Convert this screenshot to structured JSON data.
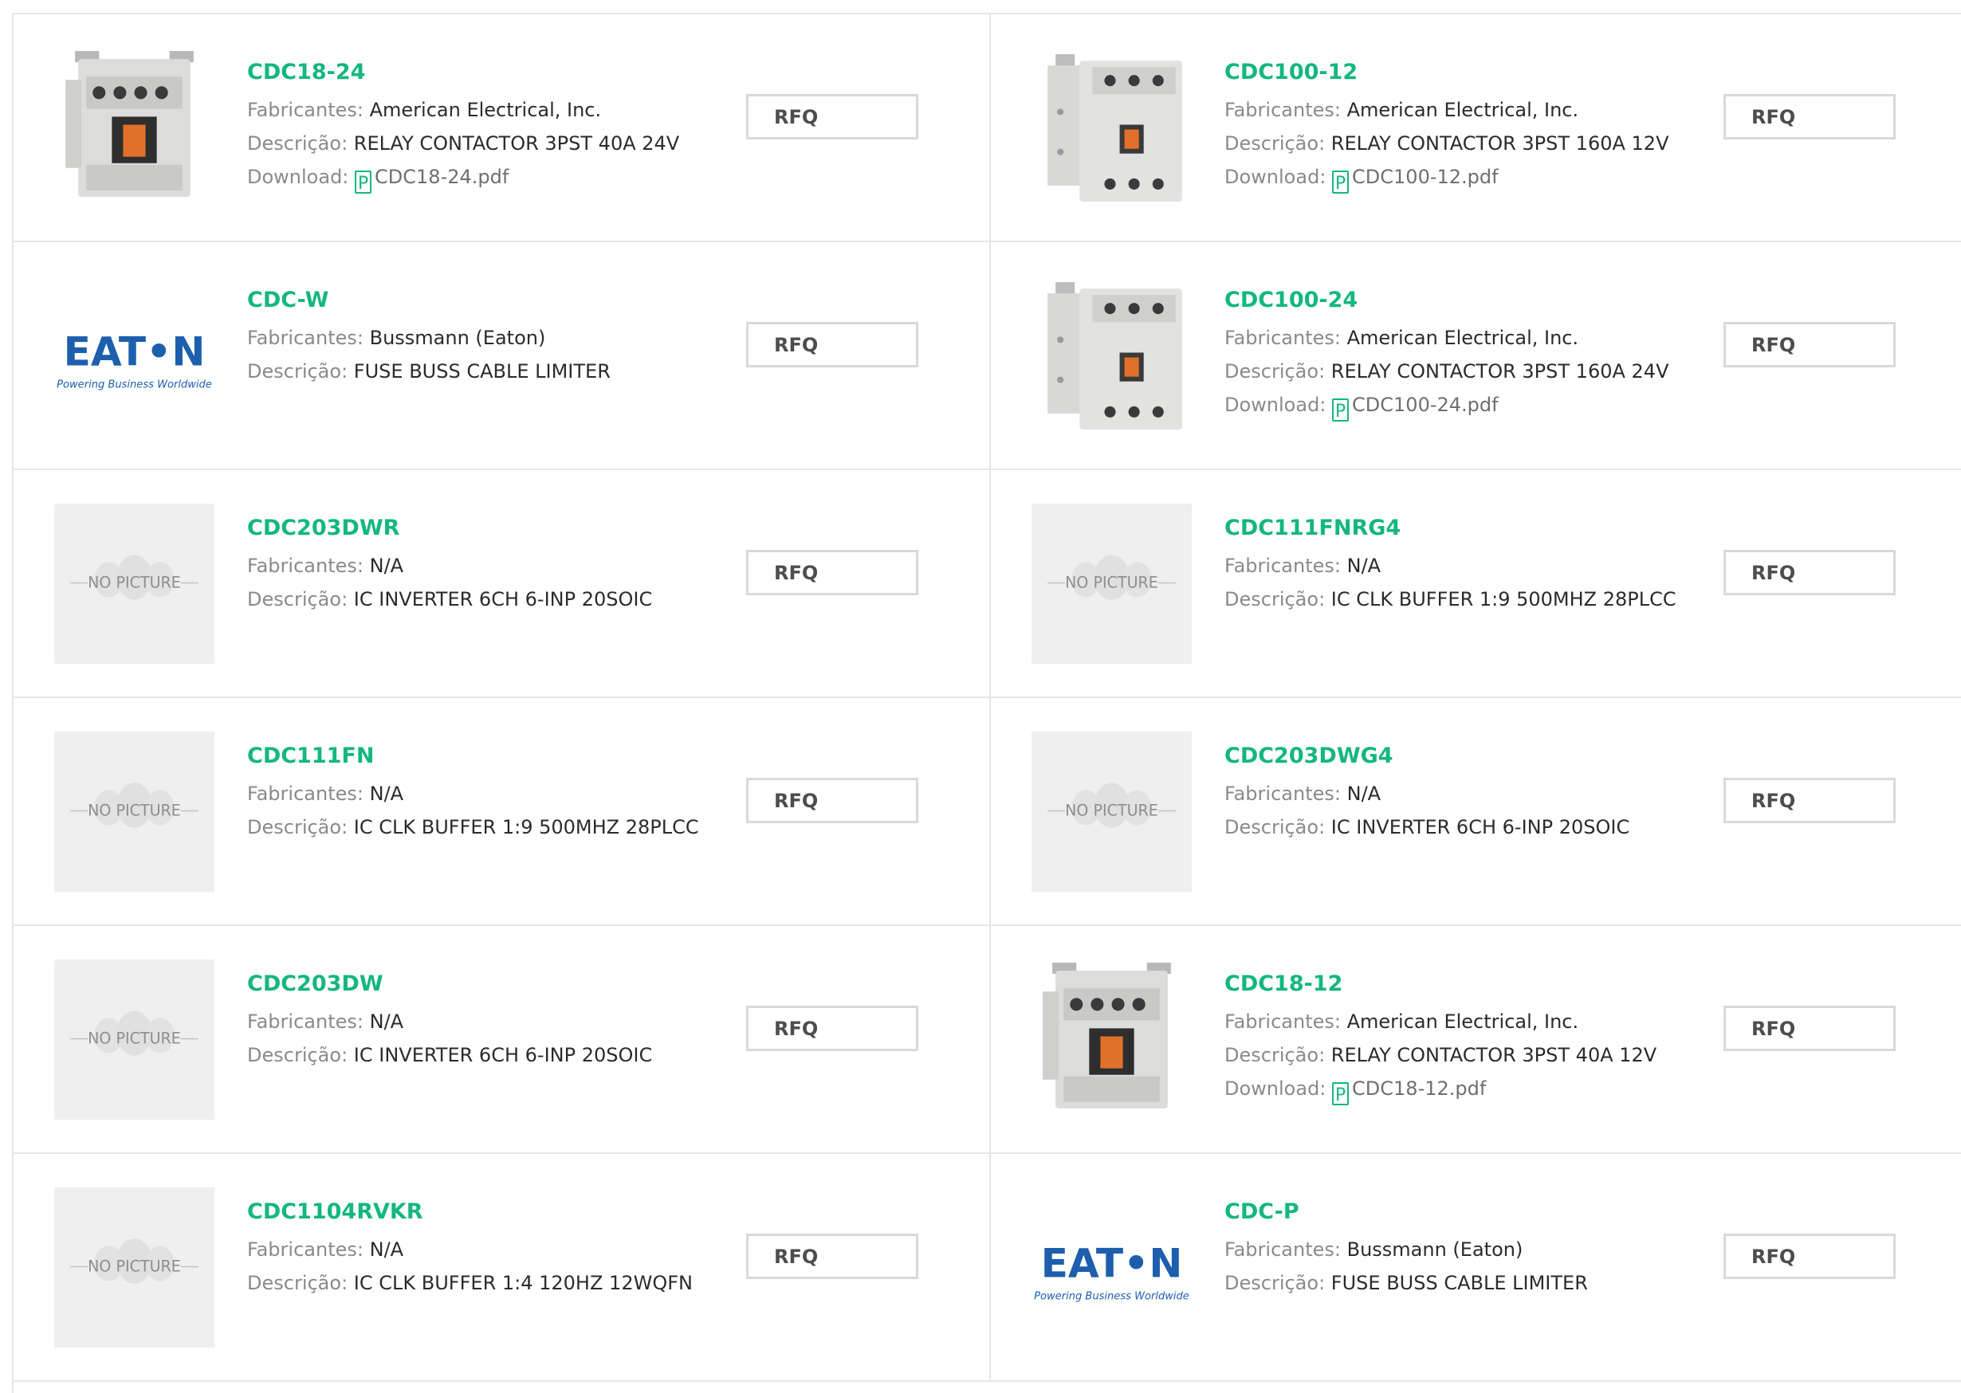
{
  "labels": {
    "manufacturer": "Fabricantes:",
    "description": "Descrição:",
    "download": "Download:",
    "rfq": "RFQ",
    "no_picture": "NO PICTURE",
    "pdf_icon_glyph": "P",
    "eaton_logo": "EAT•N",
    "eaton_tagline": "Powering Business Worldwide"
  },
  "colors": {
    "accent": "#14b681",
    "eaton_blue": "#1d5fad"
  },
  "products": [
    {
      "part": "CDC18-24",
      "manufacturer": "American Electrical, Inc.",
      "description": "RELAY CONTACTOR 3PST 40A 24V",
      "download": "CDC18-24.pdf",
      "image": "contactor-small"
    },
    {
      "part": "CDC100-12",
      "manufacturer": "American Electrical, Inc.",
      "description": "RELAY CONTACTOR 3PST 160A 12V",
      "download": "CDC100-12.pdf",
      "image": "contactor-large"
    },
    {
      "part": "CDC-W",
      "manufacturer": "Bussmann (Eaton)",
      "description": "FUSE BUSS CABLE LIMITER",
      "download": null,
      "image": "eaton-logo"
    },
    {
      "part": "CDC100-24",
      "manufacturer": "American Electrical, Inc.",
      "description": "RELAY CONTACTOR 3PST 160A 24V",
      "download": "CDC100-24.pdf",
      "image": "contactor-large"
    },
    {
      "part": "CDC203DWR",
      "manufacturer": "N/A",
      "description": "IC INVERTER 6CH 6-INP 20SOIC",
      "download": null,
      "image": "no-picture"
    },
    {
      "part": "CDC111FNRG4",
      "manufacturer": "N/A",
      "description": "IC CLK BUFFER 1:9 500MHZ 28PLCC",
      "download": null,
      "image": "no-picture"
    },
    {
      "part": "CDC111FN",
      "manufacturer": "N/A",
      "description": "IC CLK BUFFER 1:9 500MHZ 28PLCC",
      "download": null,
      "image": "no-picture"
    },
    {
      "part": "CDC203DWG4",
      "manufacturer": "N/A",
      "description": "IC INVERTER 6CH 6-INP 20SOIC",
      "download": null,
      "image": "no-picture"
    },
    {
      "part": "CDC203DW",
      "manufacturer": "N/A",
      "description": "IC INVERTER 6CH 6-INP 20SOIC",
      "download": null,
      "image": "no-picture"
    },
    {
      "part": "CDC18-12",
      "manufacturer": "American Electrical, Inc.",
      "description": "RELAY CONTACTOR 3PST 40A 12V",
      "download": "CDC18-12.pdf",
      "image": "contactor-small"
    },
    {
      "part": "CDC1104RVKR",
      "manufacturer": "N/A",
      "description": "IC CLK BUFFER 1:4 120HZ 12WQFN",
      "download": null,
      "image": "no-picture"
    },
    {
      "part": "CDC-P",
      "manufacturer": "Bussmann (Eaton)",
      "description": "FUSE BUSS CABLE LIMITER",
      "download": null,
      "image": "eaton-logo"
    }
  ]
}
